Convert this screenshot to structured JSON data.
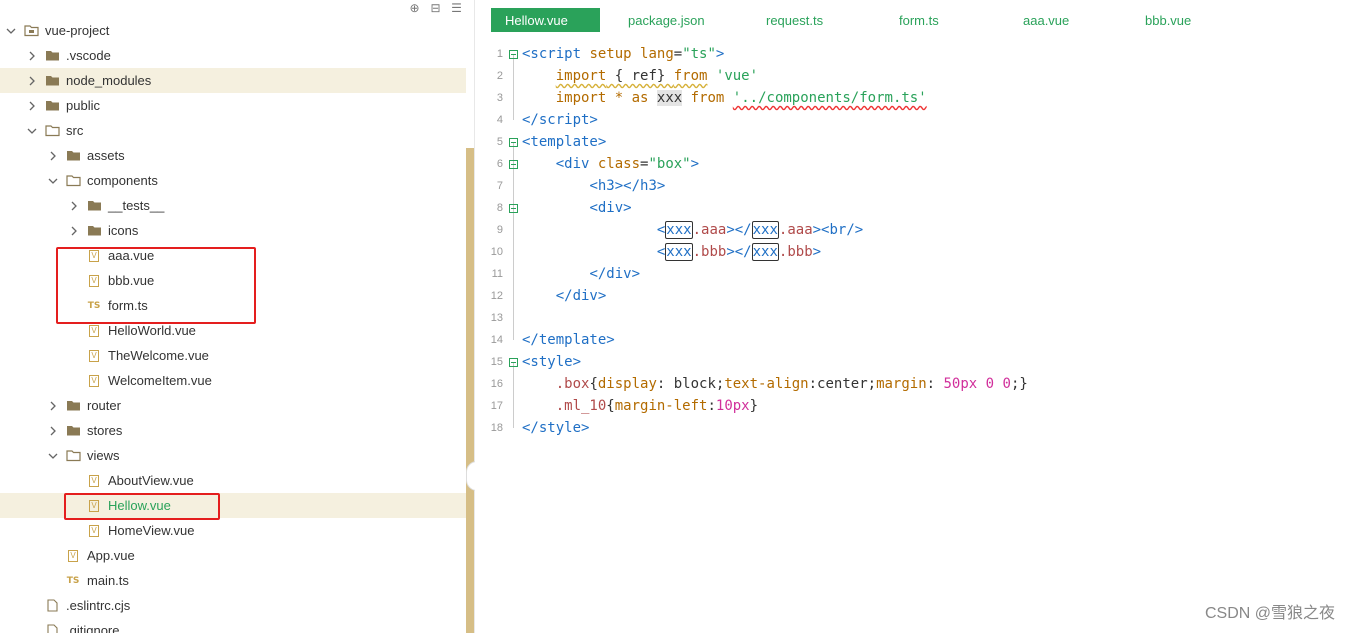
{
  "explorer": {
    "toolbar": [
      "locate-icon",
      "collapse-all-icon",
      "menu-icon"
    ],
    "rows": [
      {
        "label": "vue-project",
        "kind": "project",
        "depth": 0,
        "expanded": true
      },
      {
        "label": ".vscode",
        "kind": "folder",
        "depth": 1,
        "expanded": false
      },
      {
        "label": "node_modules",
        "kind": "folder",
        "depth": 1,
        "expanded": false,
        "hover": true
      },
      {
        "label": "public",
        "kind": "folder",
        "depth": 1,
        "expanded": false
      },
      {
        "label": "src",
        "kind": "folder",
        "depth": 1,
        "expanded": true
      },
      {
        "label": "assets",
        "kind": "folder",
        "depth": 2,
        "expanded": false
      },
      {
        "label": "components",
        "kind": "folder",
        "depth": 2,
        "expanded": true
      },
      {
        "label": "__tests__",
        "kind": "folder",
        "depth": 3,
        "expanded": false
      },
      {
        "label": "icons",
        "kind": "folder",
        "depth": 3,
        "expanded": false
      },
      {
        "label": "aaa.vue",
        "kind": "vue",
        "depth": 3
      },
      {
        "label": "bbb.vue",
        "kind": "vue",
        "depth": 3
      },
      {
        "label": "form.ts",
        "kind": "ts",
        "depth": 3
      },
      {
        "label": "HelloWorld.vue",
        "kind": "vue",
        "depth": 3
      },
      {
        "label": "TheWelcome.vue",
        "kind": "vue",
        "depth": 3
      },
      {
        "label": "WelcomeItem.vue",
        "kind": "vue",
        "depth": 3
      },
      {
        "label": "router",
        "kind": "folder",
        "depth": 2,
        "expanded": false
      },
      {
        "label": "stores",
        "kind": "folder",
        "depth": 2,
        "expanded": false
      },
      {
        "label": "views",
        "kind": "folder",
        "depth": 2,
        "expanded": true
      },
      {
        "label": "AboutView.vue",
        "kind": "vue",
        "depth": 3
      },
      {
        "label": "Hellow.vue",
        "kind": "vue",
        "depth": 3,
        "selected": true
      },
      {
        "label": "HomeView.vue",
        "kind": "vue",
        "depth": 3
      },
      {
        "label": "App.vue",
        "kind": "vue",
        "depth": 2
      },
      {
        "label": "main.ts",
        "kind": "ts",
        "depth": 2
      },
      {
        "label": ".eslintrc.cjs",
        "kind": "file",
        "depth": 1
      },
      {
        "label": ".gitignore",
        "kind": "file",
        "depth": 1
      }
    ]
  },
  "tabs": [
    "Hellow.vue",
    "package.json",
    "request.ts",
    "form.ts",
    "aaa.vue",
    "bbb.vue"
  ],
  "active_tab": "Hellow.vue",
  "editor": {
    "line_numbers": [
      "1",
      "2",
      "3",
      "4",
      "5",
      "6",
      "7",
      "8",
      "9",
      "10",
      "11",
      "12",
      "13",
      "14",
      "15",
      "16",
      "17",
      "18"
    ]
  },
  "colors": {
    "accent": "#2aa25a",
    "highlight_box": "#e41e1e",
    "tag": "#1f6fc5",
    "attr": "#b36b00"
  },
  "watermark": "CSDN @雪狼之夜"
}
